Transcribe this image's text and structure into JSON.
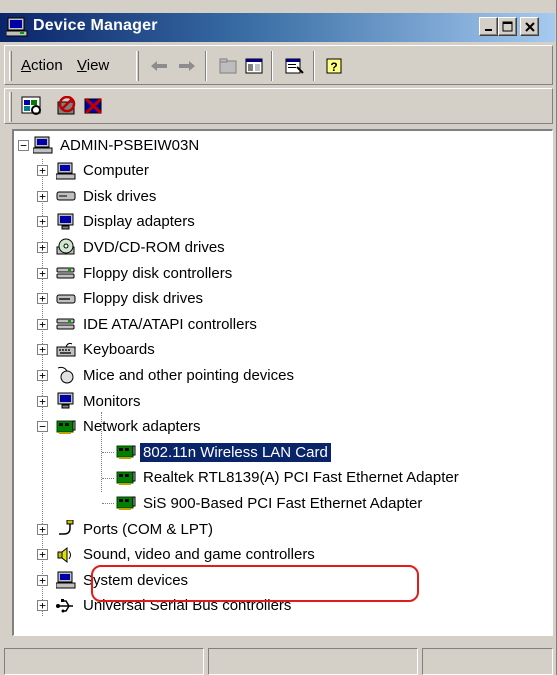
{
  "window": {
    "title": "Device Manager"
  },
  "menu": {
    "action": "Action",
    "action_key": "A",
    "view": "View",
    "view_key": "V"
  },
  "tree": {
    "root": "ADMIN-PSBEIW03N",
    "items": [
      {
        "label": "Computer",
        "icon": "computer-icon"
      },
      {
        "label": "Disk drives",
        "icon": "disk-drive-icon"
      },
      {
        "label": "Display adapters",
        "icon": "monitor-icon"
      },
      {
        "label": "DVD/CD-ROM drives",
        "icon": "cdrom-icon"
      },
      {
        "label": "Floppy disk controllers",
        "icon": "controller-icon"
      },
      {
        "label": "Floppy disk drives",
        "icon": "floppy-drive-icon"
      },
      {
        "label": "IDE ATA/ATAPI controllers",
        "icon": "controller-icon"
      },
      {
        "label": "Keyboards",
        "icon": "keyboard-icon"
      },
      {
        "label": "Mice and other pointing devices",
        "icon": "mouse-icon"
      },
      {
        "label": "Monitors",
        "icon": "monitor-icon"
      },
      {
        "label": "Network adapters",
        "icon": "network-card-icon"
      },
      {
        "label": "Ports (COM & LPT)",
        "icon": "port-icon"
      },
      {
        "label": "Sound, video and game controllers",
        "icon": "speaker-icon"
      },
      {
        "label": "System devices",
        "icon": "computer-icon"
      },
      {
        "label": "Universal Serial Bus controllers",
        "icon": "usb-icon"
      }
    ],
    "network_children": [
      {
        "label": "802.11n Wireless LAN Card",
        "selected": true
      },
      {
        "label": "Realtek RTL8139(A) PCI Fast Ethernet Adapter",
        "selected": false
      },
      {
        "label": "SiS 900-Based PCI Fast Ethernet Adapter",
        "selected": false
      }
    ]
  },
  "colors": {
    "highlight_ring": "#e31b1b",
    "selection": "#0a246a",
    "title_start": "#0a246a",
    "title_end": "#a6caf0"
  }
}
